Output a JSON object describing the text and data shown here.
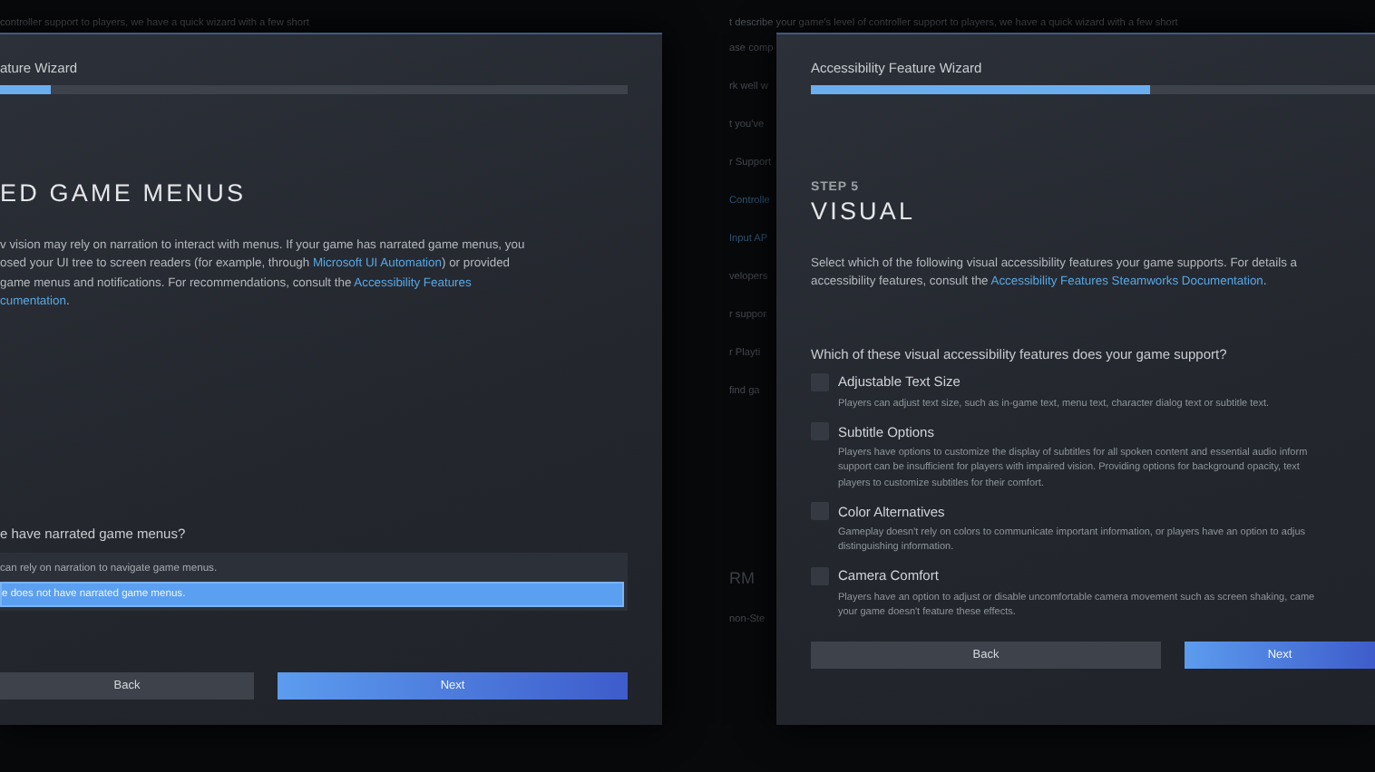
{
  "background_page": {
    "top_lines": [
      "controller support to players, we have a quick wizard with a few short",
      "t describe your game's level of controller support to players, we have a quick wizard with a few short"
    ],
    "side_fragments": [
      {
        "text": "ase comp",
        "kind": "text"
      },
      {
        "text": "rk well w",
        "kind": "text"
      },
      {
        "text": "t you've",
        "kind": "text"
      },
      {
        "text": "r Support",
        "kind": "text"
      },
      {
        "text": "Controlle",
        "kind": "link"
      },
      {
        "text": "Input AP",
        "kind": "link"
      },
      {
        "text": "velopers",
        "kind": "text"
      },
      {
        "text": "r suppor",
        "kind": "text"
      },
      {
        "text": "r Playti",
        "kind": "text"
      },
      {
        "text": "find ga",
        "kind": "text"
      },
      {
        "text": "RM",
        "kind": "heading"
      },
      {
        "text": "non-Ste",
        "kind": "text"
      }
    ]
  },
  "dialogs": [
    {
      "title": "ature Wizard",
      "progress": {
        "level": 0.08
      },
      "heading": "ED GAME MENUS",
      "description": [
        [
          {
            "text": "v vision may rely on narration to interact with menus. If your game has narrated game menus, you",
            "kind": "text"
          }
        ],
        [
          {
            "text": "osed your UI tree to screen readers (for example, through ",
            "kind": "text"
          },
          {
            "text": "Microsoft UI Automation",
            "kind": "link"
          },
          {
            "text": ") or provided",
            "kind": "text"
          }
        ],
        [
          {
            "text": " game menus and notifications. For recommendations, consult the ",
            "kind": "text"
          },
          {
            "text": "Accessibility Features",
            "kind": "link"
          }
        ],
        [
          {
            "text": "cumentation",
            "kind": "link"
          },
          {
            "text": ".",
            "kind": "text"
          }
        ]
      ],
      "question": "e have narrated game menus?",
      "kind": "choice",
      "options": [
        {
          "label": "can rely on narration to navigate game menus.",
          "selected": false
        },
        {
          "label": "e does not have narrated game menus.",
          "selected": true
        }
      ],
      "buttons": [
        {
          "label": "Back",
          "kind": "secondary"
        },
        {
          "label": "Next",
          "kind": "primary"
        }
      ]
    },
    {
      "title": "Accessibility Feature Wizard",
      "progress": {
        "level": 0.6
      },
      "step": "STEP 5",
      "heading": "VISUAL",
      "description": [
        [
          {
            "text": "Select which of the following visual accessibility features your game supports. For details a",
            "kind": "text"
          }
        ],
        [
          {
            "text": "accessibility features, consult the ",
            "kind": "text"
          },
          {
            "text": "Accessibility Features Steamworks Documentation",
            "kind": "link"
          },
          {
            "text": ".",
            "kind": "text"
          }
        ]
      ],
      "question": "Which of these visual accessibility features does your game support?",
      "kind": "checklist",
      "options": [
        {
          "label": "Adjustable Text Size",
          "checked": false,
          "description": [
            "Players can adjust text size, such as in-game text, menu text, character dialog text or subtitle text."
          ]
        },
        {
          "label": "Subtitle Options",
          "checked": false,
          "description": [
            "Players have options to customize the display of subtitles for all spoken content and essential audio inform",
            "support can be insufficient for players with impaired vision. Providing options for background opacity, text",
            "players to customize subtitles for their comfort."
          ]
        },
        {
          "label": "Color Alternatives",
          "checked": false,
          "description": [
            "Gameplay doesn't rely on colors to communicate important information, or players have an option to adjus",
            "distinguishing information."
          ]
        },
        {
          "label": "Camera Comfort",
          "checked": false,
          "description": [
            "Players have an option to adjust or disable uncomfortable camera movement such as screen shaking, came",
            "your game doesn't feature these effects."
          ]
        }
      ],
      "buttons": [
        {
          "label": "Back",
          "kind": "secondary"
        },
        {
          "label": "Next",
          "kind": "primary"
        }
      ]
    }
  ]
}
